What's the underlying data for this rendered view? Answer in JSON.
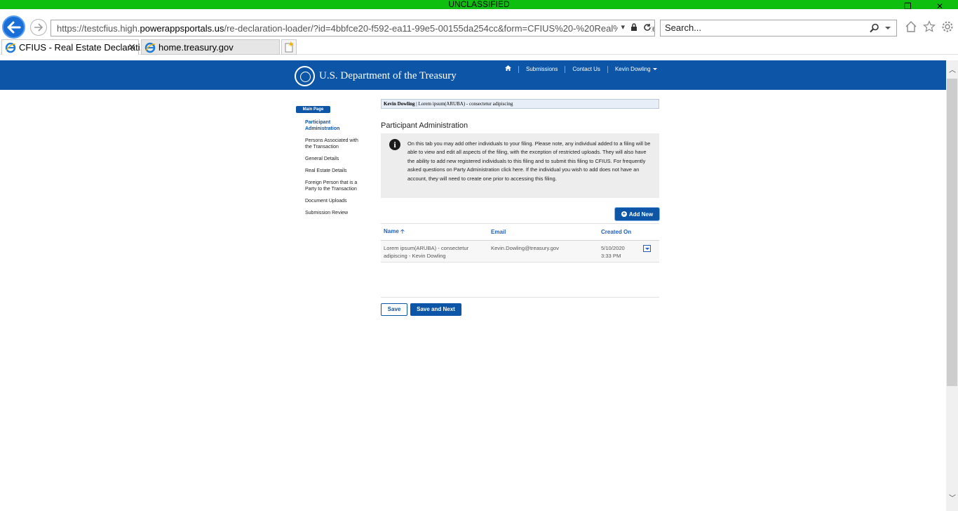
{
  "banner": {
    "label": "UNCLASSIFIED"
  },
  "browser": {
    "url_prefix": "https://testcfius.high.",
    "url_domain": "powerappsportals.us",
    "url_path": "/re-declaration-loader/?id=4bbfce20-f592-ea11-99e5-00155da254cc&form=CFIUS%20-%20Real%20Estate%",
    "search_placeholder": "Search...",
    "tabs": [
      {
        "label": "CFIUS - Real Estate Declarati...",
        "active": true
      },
      {
        "label": "home.treasury.gov",
        "active": false
      }
    ]
  },
  "site": {
    "brand": "U.S. Department of the Treasury",
    "nav": {
      "submissions": "Submissions",
      "contact": "Contact Us",
      "user": "Kevin Dowling"
    }
  },
  "sidebar": {
    "main_page": "Main Page",
    "items": [
      {
        "label": "Participant Administration",
        "active": true
      },
      {
        "label": "Persons Associated with the Transaction",
        "active": false
      },
      {
        "label": "General Details",
        "active": false
      },
      {
        "label": "Real Estate Details",
        "active": false
      },
      {
        "label": "Foreign Person that is a Party to the Transaction",
        "active": false
      },
      {
        "label": "Document Uploads",
        "active": false
      },
      {
        "label": "Submission Review",
        "active": false
      }
    ]
  },
  "content": {
    "crumb_name": "Kevin Dowling",
    "crumb_sep": "|",
    "crumb_filing": "Lorem ipsum(ARUBA) - consectetur adipiscing",
    "title": "Participant Administration",
    "info": "On this tab you may add other individuals to your filing. Please note, any individual added to a filing will be able to view and edit all aspects of the filing, with the exception of restricted uploads. They will also have the ability to add new registered individuals to this filing and to submit this filing to CFIUS. For frequently asked questions on Party Administration click here. If the individual you wish to add does not have an account, they will need to create one prior to accessing this filing.",
    "add_new": "Add New",
    "table": {
      "headers": {
        "name": "Name",
        "email": "Email",
        "created": "Created On"
      },
      "rows": [
        {
          "name": "Lorem ipsum(ARUBA) - consectetur adipiscing - Kevin Dowling",
          "email": "Kevin.Dowling@treasury.gov",
          "created_date": "5/10/2020",
          "created_time": "3:33 PM"
        }
      ]
    },
    "save": "Save",
    "save_next": "Save and Next"
  },
  "colors": {
    "banner": "#0fbf0f",
    "header": "#0d55a6",
    "link": "#1f5fbf"
  }
}
